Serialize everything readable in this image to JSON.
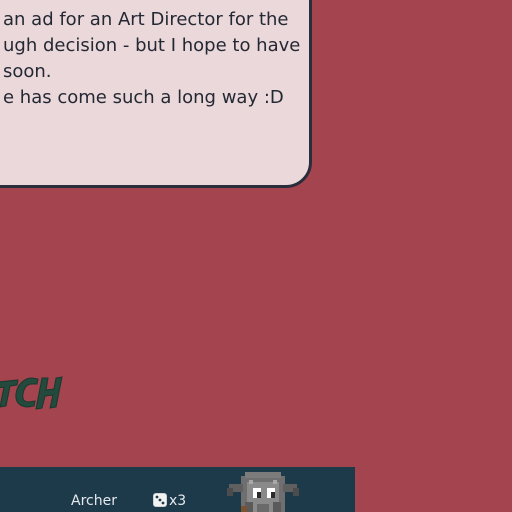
{
  "dialog": {
    "lines": [
      "an ad for an Art Director for the",
      "ugh decision - but I hope to have",
      "soon.",
      "e has come such a long way :D"
    ]
  },
  "logo": {
    "text": "TCH",
    "color": "#234a3d"
  },
  "unit_bar": {
    "unit_name": "Archer",
    "dice_icon": "dice-icon",
    "dice_count": "x3",
    "portrait_icon": "creature-portrait-icon"
  },
  "colors": {
    "background": "#a3444e",
    "dialog_fill": "#ead8da",
    "dialog_border": "#2a2d3a",
    "bar": "#1d3a4a",
    "bar_text": "#e6e9ee"
  }
}
